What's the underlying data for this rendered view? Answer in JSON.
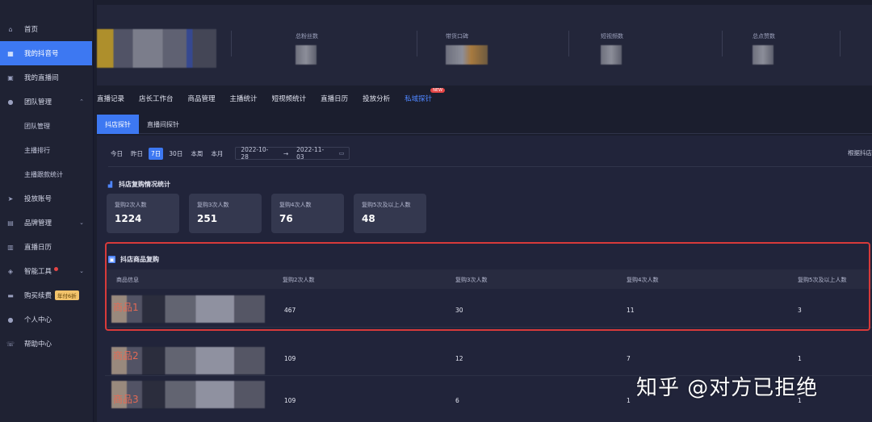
{
  "sidebar": {
    "items": [
      {
        "label": "首页",
        "icon": "home-icon"
      },
      {
        "label": "我的抖音号",
        "icon": "grid-icon",
        "active": true
      },
      {
        "label": "我的直播间",
        "icon": "tv-icon"
      },
      {
        "label": "团队管理",
        "icon": "team-icon"
      },
      {
        "label": "团队管理"
      },
      {
        "label": "主播排行"
      },
      {
        "label": "主播跟款统计"
      },
      {
        "label": "投放账号",
        "icon": "send-icon"
      },
      {
        "label": "品牌管理",
        "icon": "chart-icon"
      },
      {
        "label": "直播日历",
        "icon": "calendar-icon"
      },
      {
        "label": "智能工具",
        "icon": "tool-icon"
      },
      {
        "label": "购买续费",
        "icon": "card-icon",
        "badge": "年付6折"
      },
      {
        "label": "个人中心",
        "icon": "user-icon"
      },
      {
        "label": "帮助中心",
        "icon": "help-icon"
      }
    ]
  },
  "stats": [
    {
      "label": "总粉丝数"
    },
    {
      "label": "带货口碑"
    },
    {
      "label": "短视频数"
    },
    {
      "label": "总点赞数"
    }
  ],
  "tabs": [
    "直播记录",
    "店长工作台",
    "商品管理",
    "主播统计",
    "短视频统计",
    "直播日历",
    "投放分析",
    "私域探针"
  ],
  "new_badge": "NEW",
  "subtabs": [
    "抖店探针",
    "直播间探针"
  ],
  "date_chips": [
    "今日",
    "昨日",
    "7日",
    "30日",
    "本周",
    "本月"
  ],
  "date_range": {
    "start": "2022-10-28",
    "sep": "→",
    "end": "2022-11-03"
  },
  "by_shop": "根据抖店",
  "repurchase_title": "抖店复购情况统计",
  "cards": [
    {
      "label": "复购2次人数",
      "value": "1224"
    },
    {
      "label": "复购3次人数",
      "value": "251"
    },
    {
      "label": "复购4次人数",
      "value": "76"
    },
    {
      "label": "复购5次及以上人数",
      "value": "48"
    }
  ],
  "product_title": "抖店商品复购",
  "table": {
    "headers": [
      "商品信息",
      "复购2次人数",
      "复购3次人数",
      "复购4次人数",
      "复购5次及以上人数"
    ],
    "rows": [
      {
        "tag": "商品1",
        "values": [
          "467",
          "30",
          "11",
          "3"
        ]
      },
      {
        "tag": "商品2",
        "values": [
          "109",
          "12",
          "7",
          "1"
        ]
      },
      {
        "tag": "商品3",
        "values": [
          "109",
          "6",
          "1",
          "1"
        ]
      }
    ]
  },
  "watermark": "知乎 @对方已拒绝",
  "colors": {
    "accent": "#3d78f2",
    "highlight": "#d83a3a"
  }
}
